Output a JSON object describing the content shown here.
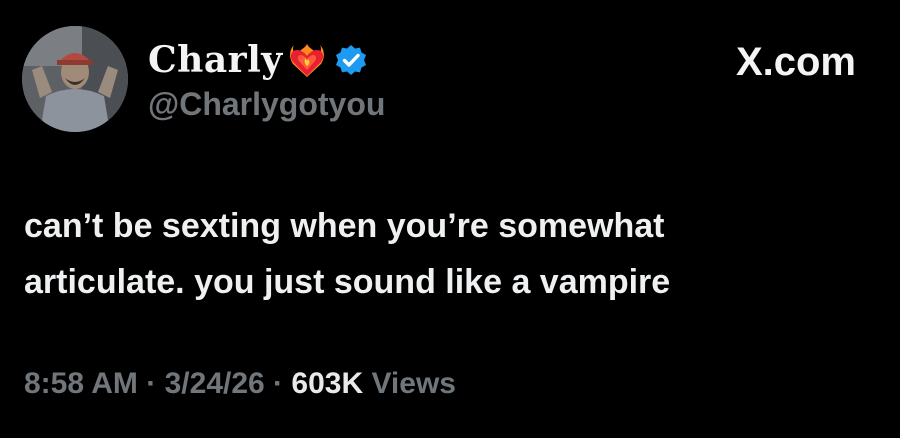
{
  "tweet": {
    "author": {
      "display_name": "Charly",
      "name_emoji": "heart-on-fire-icon",
      "verified": true,
      "handle": "@Charlygotyou"
    },
    "source": "X.com",
    "text_lines": [
      "can’t be sexting when you’re somewhat",
      "articulate. you just sound like a vampire"
    ],
    "time": "8:58 AM",
    "separator": "·",
    "date": "3/24/26",
    "views_count": "603K",
    "views_label": "Views"
  },
  "colors": {
    "background": "#000000",
    "text_primary": "#e7e9ea",
    "text_secondary": "#71767b",
    "verified_badge": "#1d9bf0"
  }
}
